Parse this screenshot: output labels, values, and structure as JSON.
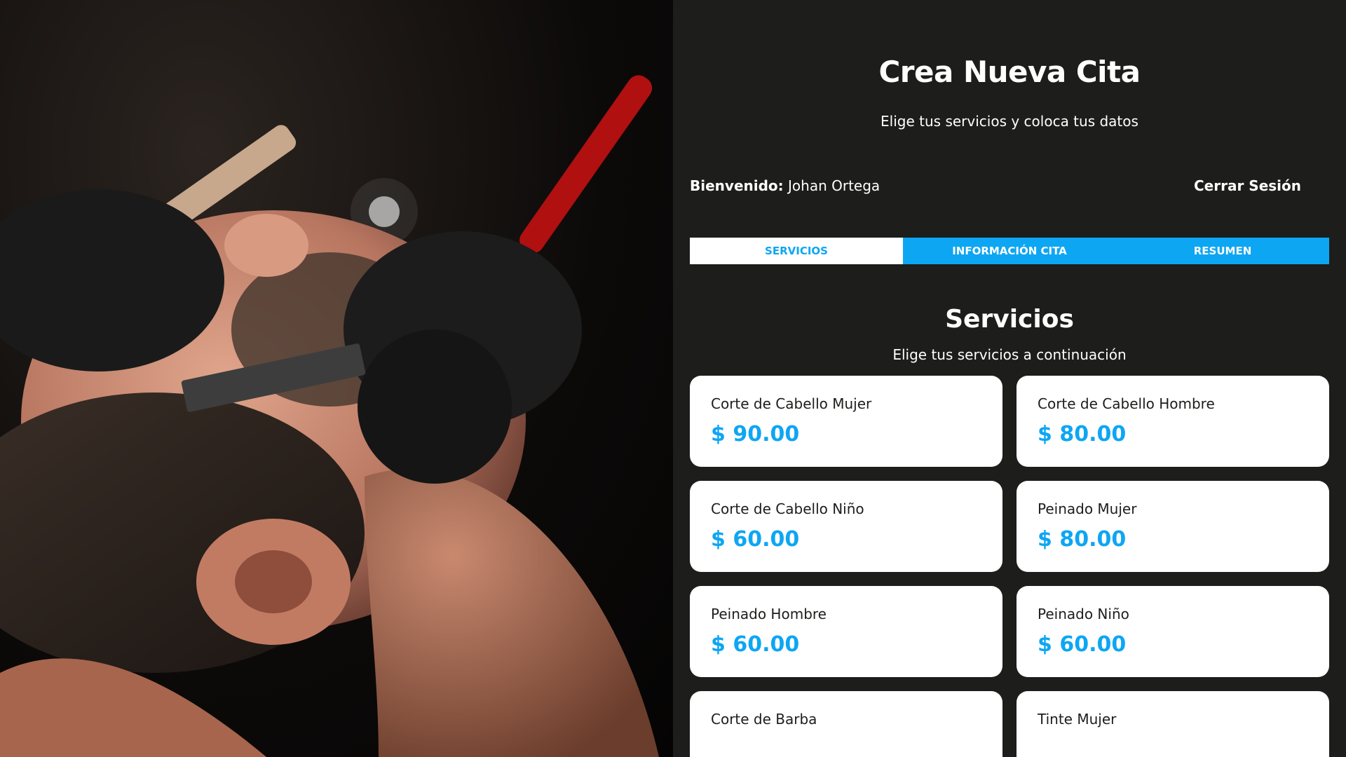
{
  "hero": {
    "image_alt": "barber-shaving-photo"
  },
  "header": {
    "title": "Crea Nueva Cita",
    "subtitle": "Elige tus servicios y coloca tus datos"
  },
  "user_bar": {
    "welcome_label": "Bienvenido:",
    "user_name": "Johan Ortega",
    "logout_label": "Cerrar Sesión"
  },
  "tabs": [
    {
      "label": "Servicios",
      "active": true
    },
    {
      "label": "Información Cita",
      "active": false
    },
    {
      "label": "Resumen",
      "active": false
    }
  ],
  "services_section": {
    "title": "Servicios",
    "subtitle": "Elige tus servicios a continuación",
    "items": [
      {
        "name": "Corte de Cabello Mujer",
        "price": "$ 90.00"
      },
      {
        "name": "Corte de Cabello Hombre",
        "price": "$ 80.00"
      },
      {
        "name": "Corte de Cabello Niño",
        "price": "$ 60.00"
      },
      {
        "name": "Peinado Mujer",
        "price": "$ 80.00"
      },
      {
        "name": "Peinado Hombre",
        "price": "$ 60.00"
      },
      {
        "name": "Peinado Niño",
        "price": "$ 60.00"
      },
      {
        "name": "Corte de Barba",
        "price": ""
      },
      {
        "name": "Tinte Mujer",
        "price": ""
      }
    ]
  },
  "colors": {
    "background": "#1d1d1b",
    "accent": "#0da6f3",
    "card": "#ffffff"
  }
}
